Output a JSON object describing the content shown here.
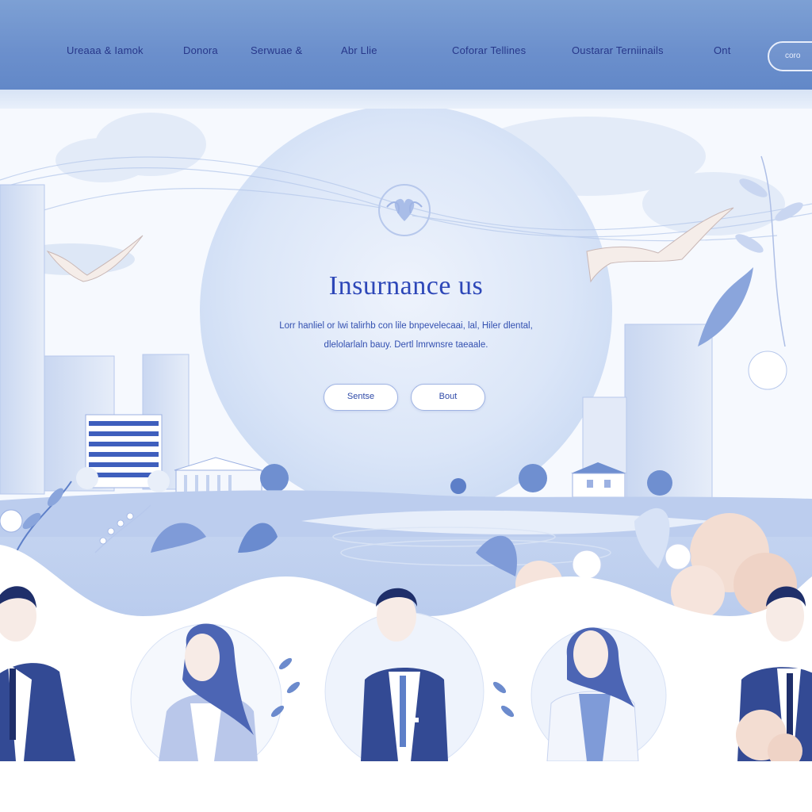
{
  "nav": {
    "items": [
      {
        "label": "Ureaaa & Iamok"
      },
      {
        "label": "Donora"
      },
      {
        "label": "Serwuae &"
      },
      {
        "label": "Abr Llie"
      },
      {
        "label": "Coforar Tellines"
      },
      {
        "label": "Oustarar Terniinails"
      },
      {
        "label": "Ont"
      }
    ],
    "cta_label": "coro"
  },
  "hero": {
    "title": "Insurnance us",
    "text_line1": "Lorr hanliel or lwi talirhb con lile bnpevelecaai, lal, Hiler dlental,",
    "text_line2": "dlelolarlaln bauy. Dertl lmrwnsre taeaale.",
    "primary_button": "Sentse",
    "secondary_button": "Bout"
  },
  "colors": {
    "nav_bg": "#6b8fcc",
    "nav_text": "#27378a",
    "title": "#2d47b8",
    "accent_blue": "#3f5fbd",
    "sky": "#dbe7f7",
    "peach": "#f3ddd2"
  },
  "icons": {
    "emblem": "heart-leaf-emblem-icon"
  }
}
